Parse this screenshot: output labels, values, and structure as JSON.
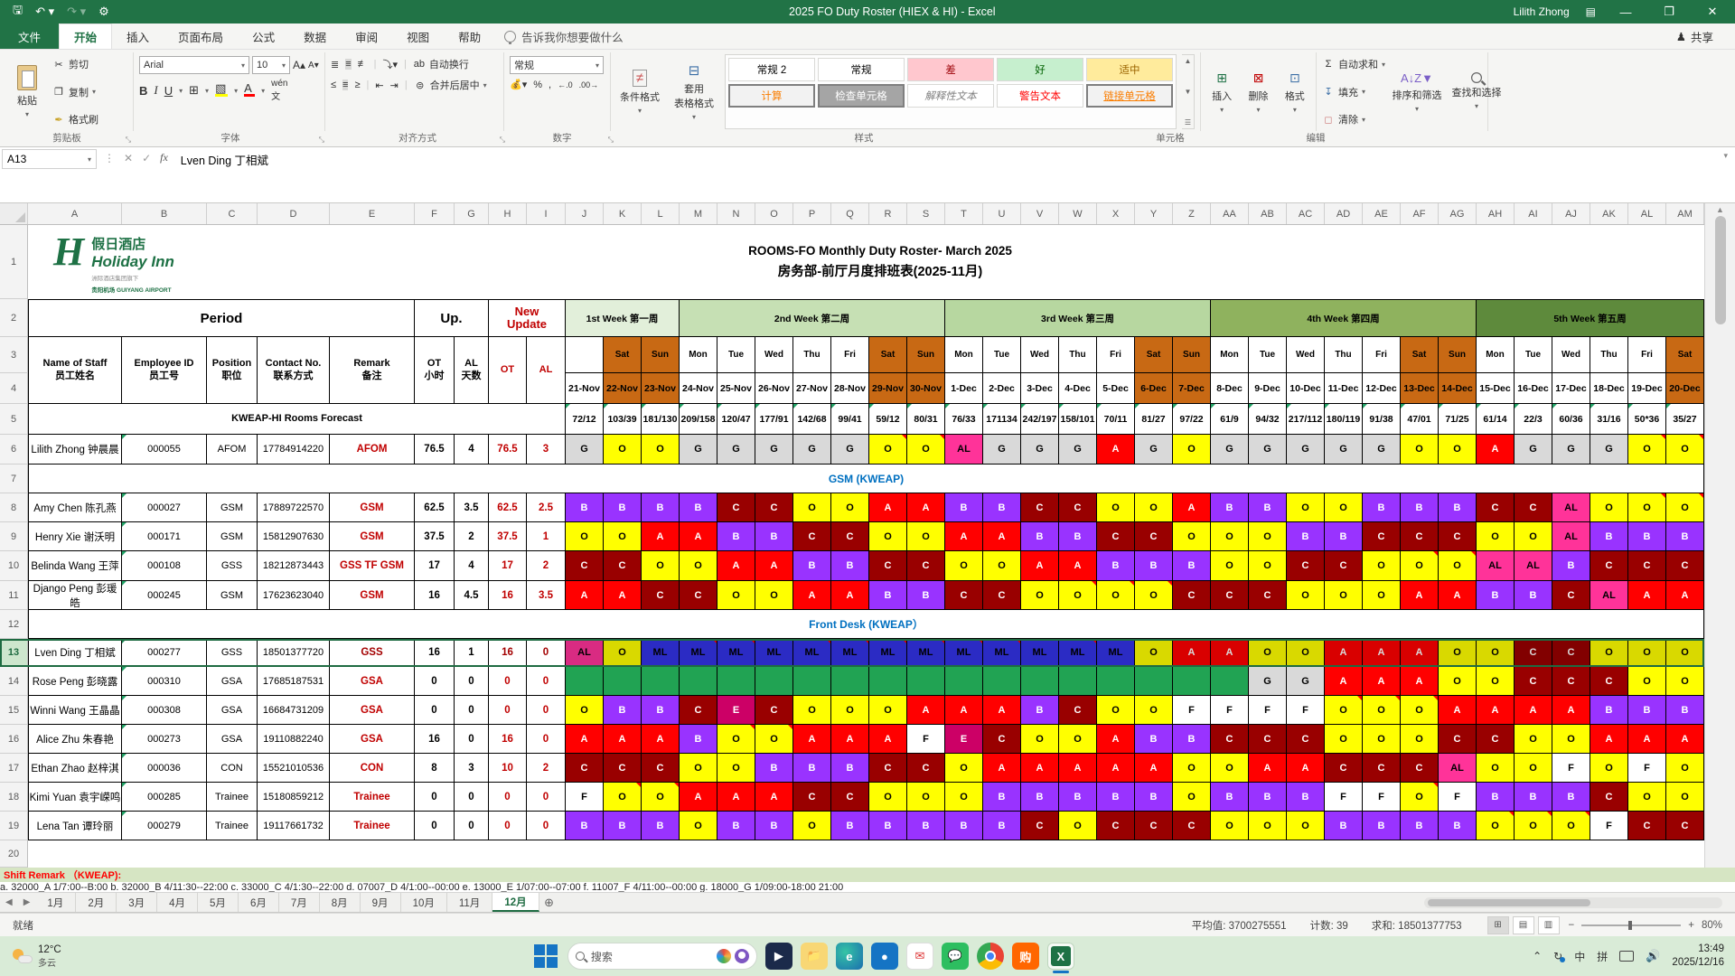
{
  "titlebar": {
    "title": "2025 FO Duty Roster (HIEX & HI)  -  Excel",
    "user": "Lilith Zhong"
  },
  "menubar": {
    "file": "文件",
    "tabs": [
      "开始",
      "插入",
      "页面布局",
      "公式",
      "数据",
      "审阅",
      "视图",
      "帮助"
    ],
    "active_tab": "开始",
    "tell_me": "告诉我你想要做什么",
    "share": "共享"
  },
  "ribbon": {
    "paste": "粘贴",
    "cut": "剪切",
    "copy": "复制",
    "painter": "格式刷",
    "font_name": "Arial",
    "font_size": "10",
    "wrap": "自动换行",
    "merge": "合并后居中",
    "number_format": "常规",
    "conditional": "条件格式",
    "table_format": "套用\n表格格式",
    "styles": [
      "常规 2",
      "常规",
      "差",
      "好",
      "适中",
      "计算",
      "检查单元格",
      "解释性文本",
      "警告文本",
      "链接单元格"
    ],
    "insert": "插入",
    "delete": "删除",
    "format": "格式",
    "autosum": "自动求和",
    "fill": "填充",
    "clear": "清除",
    "sort": "排序和筛选",
    "find": "查找和选择",
    "groups": [
      "剪贴板",
      "字体",
      "对齐方式",
      "数字",
      "样式",
      "单元格",
      "编辑"
    ]
  },
  "formula_bar": {
    "name_box": "A13",
    "value": "Lven Ding 丁相斌"
  },
  "sheet": {
    "col_letters_left": [
      "A",
      "B",
      "C",
      "D",
      "E",
      "F",
      "G",
      "H",
      "I"
    ],
    "col_letters_days": [
      "J",
      "K",
      "L",
      "M",
      "N",
      "O",
      "P",
      "Q",
      "R",
      "S",
      "T",
      "U",
      "V",
      "W",
      "X",
      "Y",
      "Z",
      "AA",
      "AB",
      "AC",
      "AD",
      "AE",
      "AF",
      "AG",
      "AH",
      "AI",
      "AJ",
      "AK",
      "AL",
      "AM"
    ],
    "logo": {
      "brand_cn": "假日酒店",
      "brand_en": "Holiday Inn",
      "sub1": "洲际酒店集团旗下",
      "sub2": "贵阳机场 GUIYANG AIRPORT"
    },
    "title_line1": "ROOMS-FO Monthly Duty Roster- March 2025",
    "title_line2": "房务部-前厅月度排班表(2025-11月)",
    "header": {
      "period": "Period",
      "up": "Up.",
      "new_update": "New\nUpdate",
      "name": "Name of Staff\n员工姓名",
      "emp": "Employee ID\n员工号",
      "pos": "Position\n职位",
      "contact": "Contact No.\n联系方式",
      "remark": "Remark\n备注",
      "ot": "OT\n小时",
      "al": "AL\n天数",
      "ot_new": "OT",
      "al_new": "AL"
    },
    "forecast_label": "KWEAP-HI Rooms Forecast",
    "weeks": [
      {
        "label": "1st Week 第一周",
        "span": 3,
        "color": "#E2EFDA"
      },
      {
        "label": "2nd Week 第二周",
        "span": 7,
        "color": "#C6E0B4"
      },
      {
        "label": "3rd Week 第三周",
        "span": 7,
        "color": "#B7D7A0"
      },
      {
        "label": "4th Week 第四周",
        "span": 7,
        "color": "#8FB25E"
      },
      {
        "label": "5th Week 第五周",
        "span": 6,
        "color": "#5E8A3C"
      }
    ],
    "days": [
      "",
      "Sat",
      "Sun",
      "Mon",
      "Tue",
      "Wed",
      "Thu",
      "Fri",
      "Sat",
      "Sun",
      "Mon",
      "Tue",
      "Wed",
      "Thu",
      "Fri",
      "Sat",
      "Sun",
      "Mon",
      "Tue",
      "Wed",
      "Thu",
      "Fri",
      "Sat",
      "Sun",
      "Mon",
      "Tue",
      "Wed",
      "Thu",
      "Fri",
      "Sat"
    ],
    "dates": [
      "21-Nov",
      "22-Nov",
      "23-Nov",
      "24-Nov",
      "25-Nov",
      "26-Nov",
      "27-Nov",
      "28-Nov",
      "29-Nov",
      "30-Nov",
      "1-Dec",
      "2-Dec",
      "3-Dec",
      "4-Dec",
      "5-Dec",
      "6-Dec",
      "7-Dec",
      "8-Dec",
      "9-Dec",
      "10-Dec",
      "11-Dec",
      "12-Dec",
      "13-Dec",
      "14-Dec",
      "15-Dec",
      "16-Dec",
      "17-Dec",
      "18-Dec",
      "19-Dec",
      "20-Dec"
    ],
    "weekend_cols": [
      1,
      2,
      8,
      9,
      15,
      16,
      22,
      23,
      29
    ],
    "forecast": [
      "72/12",
      "103/39",
      "181/130",
      "209/158",
      "120/47",
      "177/91",
      "142/68",
      "99/41",
      "59/12",
      "80/31",
      "76/33",
      "171134",
      "242/197",
      "158/101",
      "70/11",
      "81/27",
      "97/22",
      "61/9",
      "94/32",
      "217/112",
      "180/119",
      "91/38",
      "47/01",
      "71/25",
      "61/14",
      "22/3",
      "60/36",
      "31/16",
      "50*36",
      "35/27"
    ],
    "shift_colors": {
      "O": [
        "#FFFF00",
        "#000000"
      ],
      "B": [
        "#9933FF",
        "#FFFFFF"
      ],
      "C": [
        "#990000",
        "#FFFFFF"
      ],
      "A": [
        "#FF0000",
        "#FFFFFF"
      ],
      "G": [
        "#D9D9D9",
        "#000000"
      ],
      "AL": [
        "#FF3399",
        "#000000"
      ],
      "ML": [
        "#3333E6",
        "#000000"
      ],
      "E": [
        "#CC0066",
        "#FFFFFF"
      ],
      "F": [
        "#FFFFFF",
        "#000000"
      ],
      "GREEN": [
        "#21A353",
        "#21A353"
      ]
    },
    "rows": [
      {
        "rownum": 6,
        "name": "Lilith Zhong 钟晨晨",
        "emp": "000055",
        "pos": "AFOM",
        "contact": "17784914220",
        "remark": "AFOM",
        "ot": "76.5",
        "al": "4",
        "ot_new": "76.5",
        "al_new": "3",
        "shifts": [
          "G",
          "O",
          "O",
          "G",
          "G",
          "G",
          "G",
          "G",
          "O",
          "O",
          "AL",
          "G",
          "G",
          "G",
          "A",
          "G",
          "O",
          "G",
          "G",
          "G",
          "G",
          "G",
          "O",
          "O",
          "A",
          "G",
          "G",
          "G",
          "O",
          "O"
        ],
        "flags": [
          8,
          9,
          28,
          29
        ]
      },
      {
        "rownum": 7,
        "section": "GSM (KWEAP)"
      },
      {
        "rownum": 8,
        "name": "Amy Chen 陈孔燕",
        "emp": "000027",
        "pos": "GSM",
        "contact": "17889722570",
        "remark": "GSM",
        "ot": "62.5",
        "al": "3.5",
        "ot_new": "62.5",
        "al_new": "2.5",
        "shifts": [
          "B",
          "B",
          "B",
          "B",
          "C",
          "C",
          "O",
          "O",
          "A",
          "A",
          "B",
          "B",
          "C",
          "C",
          "O",
          "O",
          "A",
          "B",
          "B",
          "O",
          "O",
          "B",
          "B",
          "B",
          "C",
          "C",
          "AL",
          "O",
          "O",
          "O"
        ],
        "flags": [
          28,
          29
        ]
      },
      {
        "rownum": 9,
        "name": "Henry Xie 谢沃明",
        "emp": "000171",
        "pos": "GSM",
        "contact": "15812907630",
        "remark": "GSM",
        "ot": "37.5",
        "al": "2",
        "ot_new": "37.5",
        "al_new": "1",
        "shifts": [
          "O",
          "O",
          "A",
          "A",
          "B",
          "B",
          "C",
          "C",
          "O",
          "O",
          "A",
          "A",
          "B",
          "B",
          "C",
          "C",
          "O",
          "O",
          "O",
          "B",
          "B",
          "C",
          "C",
          "C",
          "O",
          "O",
          "AL",
          "B",
          "B",
          "B"
        ],
        "flags": []
      },
      {
        "rownum": 10,
        "name": "Belinda Wang 王萍",
        "emp": "000108",
        "pos": "GSS",
        "contact": "18212873443",
        "remark": "GSS TF GSM",
        "ot": "17",
        "al": "4",
        "ot_new": "17",
        "al_new": "2",
        "shifts": [
          "C",
          "C",
          "O",
          "O",
          "A",
          "A",
          "B",
          "B",
          "C",
          "C",
          "O",
          "O",
          "A",
          "A",
          "B",
          "B",
          "B",
          "O",
          "O",
          "C",
          "C",
          "O",
          "O",
          "O",
          "AL",
          "AL",
          "B",
          "C",
          "C",
          "C"
        ],
        "flags": [
          22,
          23
        ]
      },
      {
        "rownum": 11,
        "name": "Django Peng 彭瑗皓",
        "emp": "000245",
        "pos": "GSM",
        "contact": "17623623040",
        "remark": "GSM",
        "ot": "16",
        "al": "4.5",
        "ot_new": "16",
        "al_new": "3.5",
        "shifts": [
          "A",
          "A",
          "C",
          "C",
          "O",
          "O",
          "A",
          "A",
          "B",
          "B",
          "C",
          "C",
          "O",
          "O",
          "O",
          "O",
          "C",
          "C",
          "C",
          "O",
          "O",
          "O",
          "A",
          "A",
          "B",
          "B",
          "C",
          "AL",
          "A",
          "A"
        ],
        "flags": [
          13,
          14,
          15
        ]
      },
      {
        "rownum": 12,
        "section": "Front Desk (KWEAP）"
      },
      {
        "rownum": 13,
        "selected": true,
        "name": "Lven Ding 丁相斌",
        "emp": "000277",
        "pos": "GSS",
        "contact": "18501377720",
        "remark": "GSS",
        "ot": "16",
        "al": "1",
        "ot_new": "16",
        "al_new": "0",
        "shifts": [
          "AL",
          "O",
          "ML",
          "ML",
          "ML",
          "ML",
          "ML",
          "ML",
          "ML",
          "ML",
          "ML",
          "ML",
          "ML",
          "ML",
          "ML",
          "O",
          "A",
          "A",
          "O",
          "O",
          "A",
          "A",
          "A",
          "O",
          "O",
          "C",
          "C",
          "O",
          "O",
          "O"
        ],
        "flags": [
          3,
          4,
          6,
          7,
          8,
          9,
          10,
          11,
          13
        ]
      },
      {
        "rownum": 14,
        "name": "Rose Peng 彭晓露",
        "emp": "000310",
        "pos": "GSA",
        "contact": "17685187531",
        "remark": "GSA",
        "ot": "0",
        "al": "0",
        "ot_new": "0",
        "al_new": "0",
        "shifts": [
          "GREEN",
          "GREEN",
          "GREEN",
          "GREEN",
          "GREEN",
          "GREEN",
          "GREEN",
          "GREEN",
          "GREEN",
          "GREEN",
          "GREEN",
          "GREEN",
          "GREEN",
          "GREEN",
          "GREEN",
          "GREEN",
          "GREEN",
          "GREEN",
          "G",
          "G",
          "A",
          "A",
          "A",
          "O",
          "O",
          "C",
          "C",
          "C",
          "O",
          "O"
        ],
        "flags": []
      },
      {
        "rownum": 15,
        "name": "Winni Wang 王晶晶",
        "emp": "000308",
        "pos": "GSA",
        "contact": "16684731209",
        "remark": "GSA",
        "ot": "0",
        "al": "0",
        "ot_new": "0",
        "al_new": "0",
        "shifts": [
          "O",
          "B",
          "B",
          "C",
          "E",
          "C",
          "O",
          "O",
          "O",
          "A",
          "A",
          "A",
          "B",
          "C",
          "O",
          "O",
          "F",
          "F",
          "F",
          "F",
          "O",
          "O",
          "O",
          "A",
          "A",
          "A",
          "A",
          "B",
          "B",
          "B"
        ],
        "flags": [
          20,
          21,
          22
        ]
      },
      {
        "rownum": 16,
        "name": "Alice Zhu 朱春艳",
        "emp": "000273",
        "pos": "GSA",
        "contact": "19110882240",
        "remark": "GSA",
        "ot": "16",
        "al": "0",
        "ot_new": "16",
        "al_new": "0",
        "shifts": [
          "A",
          "A",
          "A",
          "B",
          "O",
          "O",
          "A",
          "A",
          "A",
          "F",
          "E",
          "C",
          "O",
          "O",
          "A",
          "B",
          "B",
          "C",
          "C",
          "C",
          "O",
          "O",
          "O",
          "C",
          "C",
          "O",
          "O",
          "A",
          "A",
          "A"
        ],
        "flags": [
          4,
          5
        ]
      },
      {
        "rownum": 17,
        "name": "Ethan Zhao 赵梓淇",
        "emp": "000036",
        "pos": "CON",
        "contact": "15521010536",
        "remark": "CON",
        "ot": "8",
        "al": "3",
        "ot_new": "10",
        "al_new": "2",
        "shifts": [
          "C",
          "C",
          "C",
          "O",
          "O",
          "B",
          "B",
          "B",
          "C",
          "C",
          "O",
          "A",
          "A",
          "A",
          "A",
          "A",
          "O",
          "O",
          "A",
          "A",
          "C",
          "C",
          "C",
          "AL",
          "O",
          "O",
          "F",
          "O",
          "F",
          "O"
        ],
        "flags": []
      },
      {
        "rownum": 18,
        "name": "Kimi Yuan 袁宇嵘鸣",
        "emp": "000285",
        "pos": "Trainee",
        "contact": "15180859212",
        "remark": "Trainee",
        "ot": "0",
        "al": "0",
        "ot_new": "0",
        "al_new": "0",
        "shifts": [
          "F",
          "O",
          "O",
          "A",
          "A",
          "A",
          "C",
          "C",
          "O",
          "O",
          "O",
          "B",
          "B",
          "B",
          "B",
          "B",
          "O",
          "B",
          "B",
          "B",
          "F",
          "F",
          "O",
          "F",
          "B",
          "B",
          "B",
          "C",
          "O",
          "O"
        ],
        "flags": [
          1,
          2,
          22
        ]
      },
      {
        "rownum": 19,
        "name": "Lena Tan 谭玲丽",
        "emp": "000279",
        "pos": "Trainee",
        "contact": "19117661732",
        "remark": "Trainee",
        "ot": "0",
        "al": "0",
        "ot_new": "0",
        "al_new": "0",
        "shifts": [
          "B",
          "B",
          "B",
          "O",
          "B",
          "B",
          "O",
          "B",
          "B",
          "B",
          "B",
          "B",
          "C",
          "O",
          "C",
          "C",
          "C",
          "O",
          "O",
          "O",
          "B",
          "B",
          "B",
          "B",
          "O",
          "O",
          "O",
          "F",
          "C",
          "C"
        ],
        "flags": [
          24,
          25,
          26
        ]
      }
    ],
    "remark_title": "Shift Remark （KWEAP):",
    "remark_clip": "a. 32000_A 1/7:00--B:00    b. 32000_B 4/11:30--22:00    c. 33000_C 4/1:30--22:00    d. 07007_D 4/1:00--00:00    e. 13000_E 1/07:00--07:00    f. 11007_F 4/11:00--00:00    g. 18000_G 1/09:00-18:00    21:00"
  },
  "tabs": {
    "months": [
      "1月",
      "2月",
      "3月",
      "4月",
      "5月",
      "6月",
      "7月",
      "8月",
      "9月",
      "10月",
      "11月",
      "12月"
    ],
    "active": "12月"
  },
  "statusbar": {
    "ready": "就绪",
    "average": "平均值: 3700275551",
    "count": "计数: 39",
    "sum": "求和: 18501377753",
    "zoom": "80%"
  },
  "taskbar": {
    "temperature": "12°C",
    "weather": "多云",
    "search_placeholder": "搜索",
    "ime1": "中",
    "ime2": "拼",
    "time": "13:49",
    "date": "2025/12/16",
    "apps": [
      "meeting",
      "explorer",
      "edge",
      "browser",
      "mail",
      "wechat",
      "chrome",
      "shop",
      "excel"
    ]
  },
  "colors": {
    "excel_green": "#217346",
    "weekend_orange": "#C86914",
    "row14_green": "#21A353",
    "selection_green": "#1E6B41",
    "section_blue": "#0070C0",
    "remark_red": "#FF0000"
  }
}
